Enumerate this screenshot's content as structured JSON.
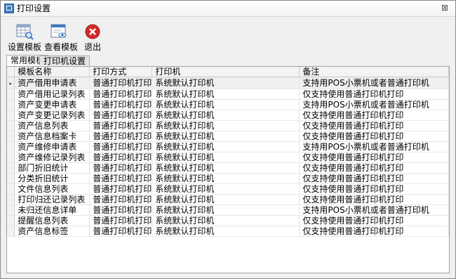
{
  "window": {
    "title": "打印设置",
    "close_glyph": "⊠"
  },
  "toolbar": {
    "buttons": [
      {
        "label": "设置模板",
        "icon": "table-settings-icon"
      },
      {
        "label": "查看模板",
        "icon": "view-template-icon"
      },
      {
        "label": "退出",
        "icon": "exit-icon"
      }
    ]
  },
  "tabs": [
    {
      "label": "常用模板",
      "active": true
    },
    {
      "label": "打印机设置",
      "active": false
    }
  ],
  "grid": {
    "columns": [
      "模板名称",
      "打印方式",
      "打印机",
      "备注"
    ],
    "rows": [
      [
        "资产借用申请表",
        "普通打印机打印",
        "系统默认打印机",
        "支持用POS小票机或者普通打印机"
      ],
      [
        "资产借用记录列表",
        "普通打印机打印",
        "系统默认打印机",
        "仅支持使用普通打印机打印"
      ],
      [
        "资产变更申请表",
        "普通打印机打印",
        "系统默认打印机",
        "支持用POS小票机或者普通打印机"
      ],
      [
        "资产变更记录列表",
        "普通打印机打印",
        "系统默认打印机",
        "仅支持使用普通打印机打印"
      ],
      [
        "资产信息列表",
        "普通打印机打印",
        "系统默认打印机",
        "仅支持使用普通打印机打印"
      ],
      [
        "资产信息档案卡",
        "普通打印机打印",
        "系统默认打印机",
        "仅支持使用普通打印机打印"
      ],
      [
        "资产维修申请表",
        "普通打印机打印",
        "系统默认打印机",
        "支持用POS小票机或者普通打印机"
      ],
      [
        "资产维修记录列表",
        "普通打印机打印",
        "系统默认打印机",
        "仅支持使用普通打印机打印"
      ],
      [
        "部门折旧统计",
        "普通打印机打印",
        "系统默认打印机",
        "仅支持使用普通打印机打印"
      ],
      [
        "分类折旧统计",
        "普通打印机打印",
        "系统默认打印机",
        "仅支持使用普通打印机打印"
      ],
      [
        "文件信息列表",
        "普通打印机打印",
        "系统默认打印机",
        "仅支持使用普通打印机打印"
      ],
      [
        "打印归还记录列表",
        "普通打印机打印",
        "系统默认打印机",
        "仅支持使用普通打印机打印"
      ],
      [
        "未归还信息详单",
        "普通打印机打印",
        "系统默认打印机",
        "支持用POS小票机或者普通打印机"
      ],
      [
        "提醒信息列表",
        "普通打印机打印",
        "系统默认打印机",
        "仅支持使用普通打印机打印"
      ],
      [
        "资产信息标签",
        "普通打印机打印",
        "系统默认打印机",
        "仅支持使用普通打印机打印"
      ]
    ],
    "selected_row": 0,
    "selected_marker": "▸"
  },
  "colors": {
    "exit_red": "#d42a2a",
    "icon_blue": "#3e78c2"
  }
}
